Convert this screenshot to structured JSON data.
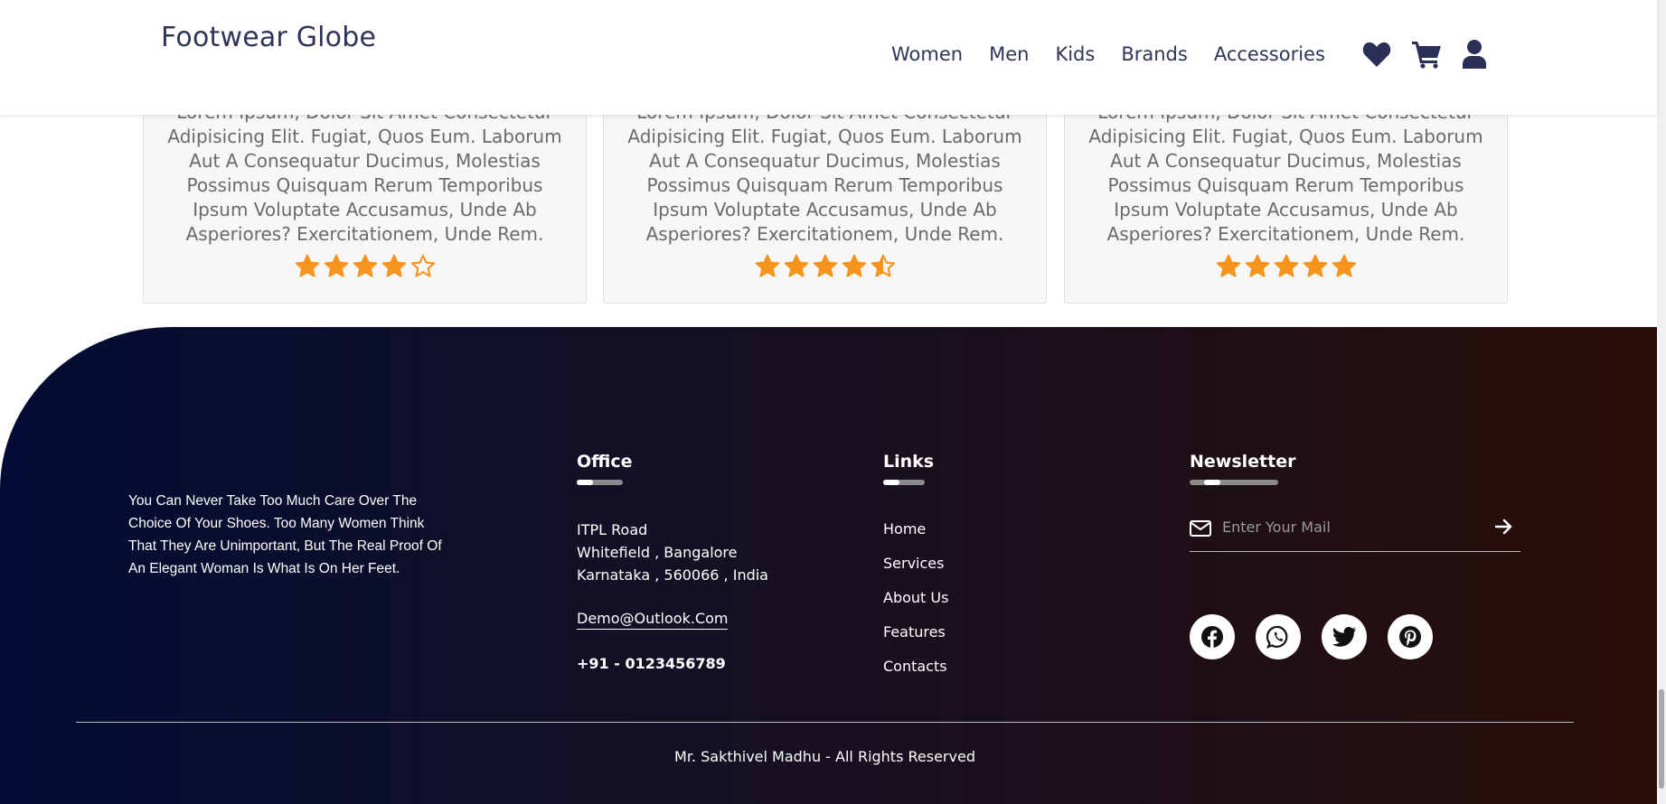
{
  "header": {
    "brand": "Footwear Globe",
    "nav": [
      "Women",
      "Men",
      "Kids",
      "Brands",
      "Accessories"
    ],
    "icons": [
      "heart-icon",
      "cart-icon",
      "user-icon"
    ]
  },
  "reviews": [
    {
      "text": "Lorem Ipsum, Dolor Sit Amet Consectetur Adipisicing Elit. Fugiat, Quos Eum. Laborum Aut A Consequatur Ducimus, Molestias Possimus Quisquam Rerum Temporibus Ipsum Voluptate Accusamus, Unde Ab Asperiores? Exercitationem, Unde Rem.",
      "rating": 4
    },
    {
      "text": "Lorem Ipsum, Dolor Sit Amet Consectetur Adipisicing Elit. Fugiat, Quos Eum. Laborum Aut A Consequatur Ducimus, Molestias Possimus Quisquam Rerum Temporibus Ipsum Voluptate Accusamus, Unde Ab Asperiores? Exercitationem, Unde Rem.",
      "rating": 4.5
    },
    {
      "text": "Lorem Ipsum, Dolor Sit Amet Consectetur Adipisicing Elit. Fugiat, Quos Eum. Laborum Aut A Consequatur Ducimus, Molestias Possimus Quisquam Rerum Temporibus Ipsum Voluptate Accusamus, Unde Ab Asperiores? Exercitationem, Unde Rem.",
      "rating": 5
    }
  ],
  "colors": {
    "star": "#f7941d",
    "brand_text": "#2f3557"
  },
  "footer": {
    "about": "You Can Never Take Too Much Care Over The Choice Of Your Shoes. Too Many Women Think That They Are Unimportant, But The Real Proof Of An Elegant Woman Is What Is On Her Feet.",
    "office": {
      "title": "Office",
      "lines": [
        "ITPL Road",
        "Whitefield , Bangalore",
        "Karnataka , 560066 , India"
      ],
      "email": "Demo@Outlook.Com",
      "phone": "+91 - 0123456789"
    },
    "links": {
      "title": "Links",
      "items": [
        "Home",
        "Services",
        "About Us",
        "Features",
        "Contacts"
      ]
    },
    "newsletter": {
      "title": "Newsletter",
      "placeholder": "Enter Your Mail"
    },
    "social": [
      "facebook-icon",
      "whatsapp-icon",
      "twitter-icon",
      "pinterest-icon"
    ],
    "copyright": "Mr. Sakthivel Madhu - All Rights Reserved"
  }
}
